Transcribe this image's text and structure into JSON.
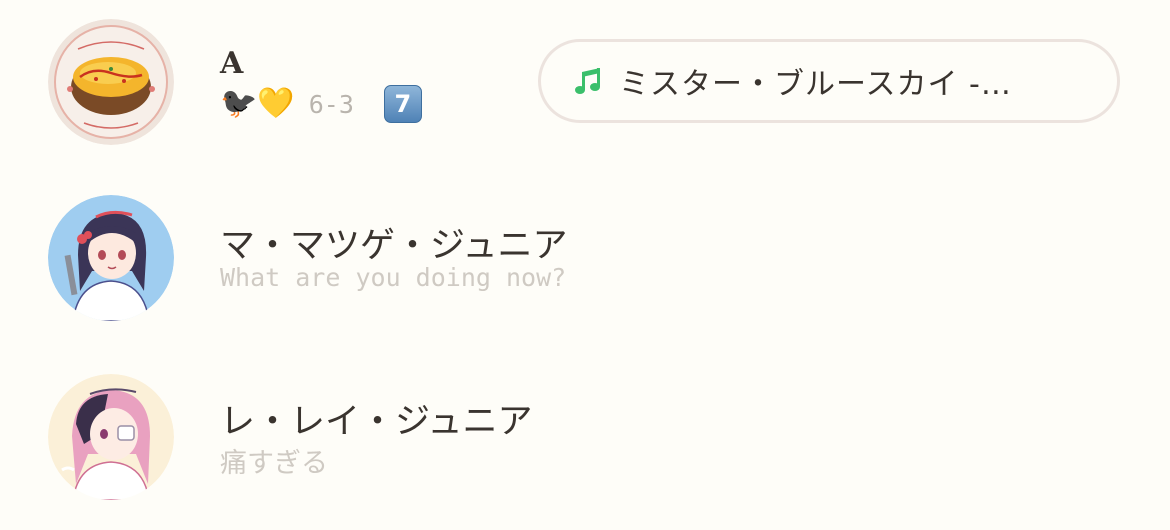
{
  "contacts": [
    {
      "name": "A",
      "status_emoji": "🐦‍⬛💛",
      "status_score": "6-3",
      "status_keycap": "7",
      "music": {
        "icon": "music-note-icon",
        "title": "ミスター・ブルースカイ -…"
      },
      "avatar": "omurice-photo"
    },
    {
      "name": "マ・マツゲ・ジュニア",
      "status": "What are you doing now?",
      "avatar": "anime-girl-blue-bg"
    },
    {
      "name": "レ・レイ・ジュニア",
      "status": "痛すぎる",
      "avatar": "anime-girl-pink-hair"
    }
  ],
  "colors": {
    "background": "#fefdf8",
    "name_text": "#3a342f",
    "status_text": "#cfcac3",
    "music_icon": "#3bbf6b",
    "pill_border": "#ece3de"
  }
}
